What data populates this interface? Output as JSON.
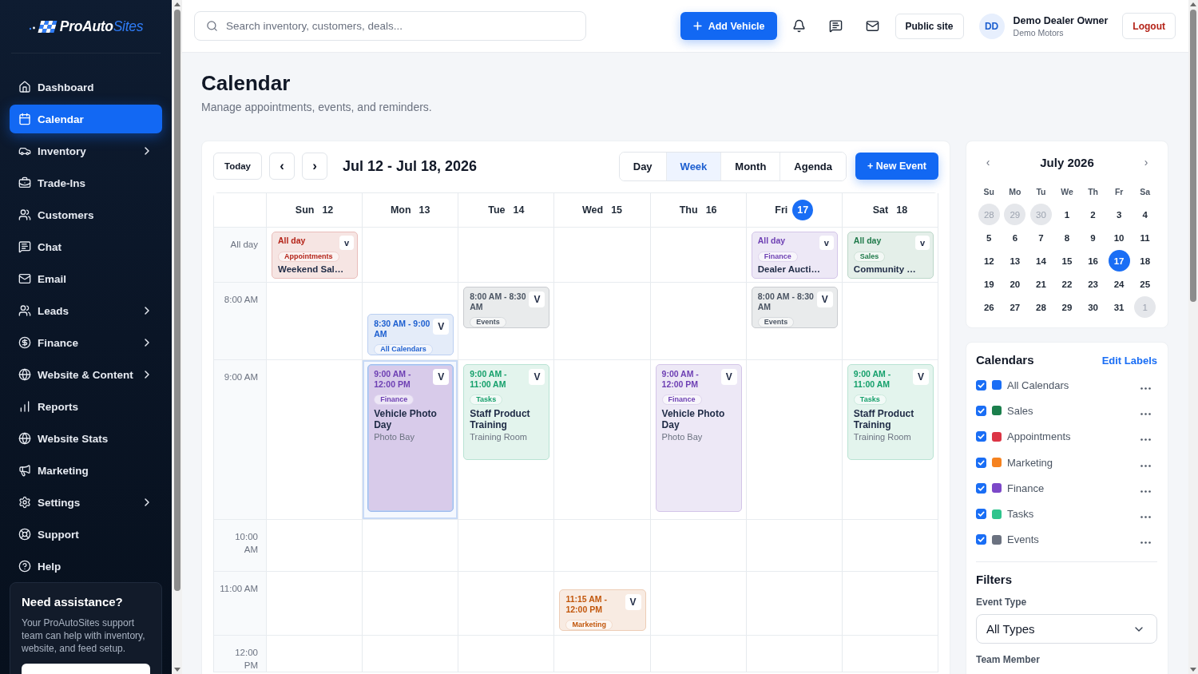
{
  "sidebar": {
    "logo": {
      "brand": "ProAuto",
      "accent": "Sites"
    },
    "nav": [
      {
        "label": "Dashboard",
        "expandable": false,
        "selected": false
      },
      {
        "label": "Calendar",
        "expandable": false,
        "selected": true
      },
      {
        "label": "Inventory",
        "expandable": true,
        "selected": false
      },
      {
        "label": "Trade-Ins",
        "expandable": false,
        "selected": false
      },
      {
        "label": "Customers",
        "expandable": false,
        "selected": false
      },
      {
        "label": "Chat",
        "expandable": false,
        "selected": false
      },
      {
        "label": "Email",
        "expandable": false,
        "selected": false
      },
      {
        "label": "Leads",
        "expandable": true,
        "selected": false
      },
      {
        "label": "Finance",
        "expandable": true,
        "selected": false
      },
      {
        "label": "Website & Content",
        "expandable": true,
        "selected": false
      },
      {
        "label": "Reports",
        "expandable": false,
        "selected": false
      },
      {
        "label": "Website Stats",
        "expandable": false,
        "selected": false
      },
      {
        "label": "Marketing",
        "expandable": false,
        "selected": false
      },
      {
        "label": "Settings",
        "expandable": true,
        "selected": false
      },
      {
        "label": "Support",
        "expandable": false,
        "selected": false
      },
      {
        "label": "Help",
        "expandable": false,
        "selected": false
      }
    ],
    "help_card": {
      "title": "Need assistance?",
      "text": "Your ProAutoSites support team can help with inventory, website, and feed setup."
    }
  },
  "topbar": {
    "search": {
      "placeholder": "Search inventory, customers, deals..."
    },
    "add_vehicle": "Add Vehicle",
    "public_site": "Public site",
    "user": {
      "initials": "DD",
      "name": "Demo Dealer Owner",
      "company": "Demo Motors"
    },
    "logout": "Logout"
  },
  "page": {
    "title": "Calendar",
    "subtitle": "Manage appointments, events, and reminders."
  },
  "calendar": {
    "today": "Today",
    "prev": "‹",
    "next": "›",
    "range": "Jul 12 - Jul 18, 2026",
    "views": [
      {
        "label": "Day",
        "selected": false
      },
      {
        "label": "Week",
        "selected": true
      },
      {
        "label": "Month",
        "selected": false
      },
      {
        "label": "Agenda",
        "selected": false
      }
    ],
    "new_event": "+ New Event",
    "days": [
      {
        "name": "Sun",
        "date": "12",
        "today": false
      },
      {
        "name": "Mon",
        "date": "13",
        "today": false
      },
      {
        "name": "Tue",
        "date": "14",
        "today": false
      },
      {
        "name": "Wed",
        "date": "15",
        "today": false
      },
      {
        "name": "Thu",
        "date": "16",
        "today": false
      },
      {
        "name": "Fri",
        "date": "17",
        "today": true
      },
      {
        "name": "Sat",
        "date": "18",
        "today": false
      }
    ],
    "rows": [
      {
        "label": "All day",
        "cells": [
          {
            "event": {
              "kind": "allday",
              "time": "All day",
              "menu": "v",
              "tag": "Appointments",
              "title": "Weekend Sal…",
              "color": "#b42318",
              "selected": false
            }
          },
          {},
          {},
          {},
          {},
          {
            "event": {
              "kind": "allday",
              "time": "All day",
              "menu": "v",
              "tag": "Finance",
              "title": "Dealer Aucti…",
              "color": "#6d3fb3",
              "selected": false
            }
          },
          {
            "event": {
              "kind": "allday",
              "time": "All day",
              "menu": "v",
              "tag": "Sales",
              "title": "Community …",
              "color": "#1f7a4a",
              "selected": false
            }
          }
        ]
      },
      {
        "label": "8:00 AM",
        "cells": [
          {},
          {
            "event": {
              "kind": "halfpast",
              "time": "8:30 AM - 9:00 AM",
              "menu": "V",
              "tag": "All Calendars",
              "color": "#1d5fd0",
              "selected": false
            }
          },
          {
            "event": {
              "kind": "brief",
              "time": "8:00 AM - 8:30 AM",
              "menu": "V",
              "tag": "Events",
              "color": "#4b5563",
              "selected": false
            }
          },
          {},
          {},
          {
            "event": {
              "kind": "brief",
              "time": "8:00 AM - 8:30 AM",
              "menu": "V",
              "tag": "Events",
              "color": "#4b5563",
              "selected": false
            }
          },
          {}
        ]
      },
      {
        "label": "9:00 AM",
        "cells": [
          {},
          {
            "event": {
              "kind": "threehour",
              "time": "9:00 AM - 12:00 PM",
              "menu": "V",
              "tag": "Finance",
              "title": "Vehicle Photo Day",
              "location": "Photo Bay",
              "color": "#6d3fb3",
              "selected": true
            }
          },
          {
            "event": {
              "kind": "twohour",
              "time": "9:00 AM - 11:00 AM",
              "menu": "V",
              "tag": "Tasks",
              "title": "Staff Product Training",
              "location": "Training Room",
              "color": "#15a06b",
              "selected": false
            }
          },
          {},
          {
            "event": {
              "kind": "threehour",
              "time": "9:00 AM - 12:00 PM",
              "menu": "V",
              "tag": "Finance",
              "title": "Vehicle Photo Day",
              "location": "Photo Bay",
              "color": "#6d3fb3",
              "selected": false
            }
          },
          {},
          {
            "event": {
              "kind": "twohour",
              "time": "9:00 AM - 11:00 AM",
              "menu": "V",
              "tag": "Tasks",
              "title": "Staff Product Training",
              "location": "Training Room",
              "color": "#15a06b",
              "selected": false
            }
          }
        ]
      },
      {
        "label": "10:00 AM",
        "cells": [
          {},
          {},
          {},
          {},
          {},
          {},
          {}
        ]
      },
      {
        "label": "11:00 AM",
        "cells": [
          {},
          {},
          {},
          {
            "event": {
              "kind": "quarterpast",
              "time": "11:15 AM - 12:00 PM",
              "menu": "V",
              "tag": "Marketing",
              "color": "#c2570c",
              "selected": false
            }
          },
          {},
          {},
          {}
        ]
      },
      {
        "label": "12:00 PM",
        "cells": [
          {},
          {},
          {},
          {},
          {},
          {},
          {}
        ]
      }
    ]
  },
  "mini_calendar": {
    "prev": "‹",
    "month": "July 2026",
    "next": "›",
    "weekdays": [
      "Su",
      "Mo",
      "Tu",
      "We",
      "Th",
      "Fr",
      "Sa"
    ],
    "weeks": [
      {
        "days": [
          {
            "label": "28",
            "outside": true,
            "selected": false
          },
          {
            "label": "29",
            "outside": true,
            "selected": false
          },
          {
            "label": "30",
            "outside": true,
            "selected": false
          },
          {
            "label": "1",
            "outside": false,
            "selected": false
          },
          {
            "label": "2",
            "outside": false,
            "selected": false
          },
          {
            "label": "3",
            "outside": false,
            "selected": false
          },
          {
            "label": "4",
            "outside": false,
            "selected": false
          }
        ]
      },
      {
        "days": [
          {
            "label": "5",
            "outside": false,
            "selected": false
          },
          {
            "label": "6",
            "outside": false,
            "selected": false
          },
          {
            "label": "7",
            "outside": false,
            "selected": false
          },
          {
            "label": "8",
            "outside": false,
            "selected": false
          },
          {
            "label": "9",
            "outside": false,
            "selected": false
          },
          {
            "label": "10",
            "outside": false,
            "selected": false
          },
          {
            "label": "11",
            "outside": false,
            "selected": false
          }
        ]
      },
      {
        "days": [
          {
            "label": "12",
            "outside": false,
            "selected": false
          },
          {
            "label": "13",
            "outside": false,
            "selected": false
          },
          {
            "label": "14",
            "outside": false,
            "selected": false
          },
          {
            "label": "15",
            "outside": false,
            "selected": false
          },
          {
            "label": "16",
            "outside": false,
            "selected": false
          },
          {
            "label": "17",
            "outside": false,
            "selected": true
          },
          {
            "label": "18",
            "outside": false,
            "selected": false
          }
        ]
      },
      {
        "days": [
          {
            "label": "19",
            "outside": false,
            "selected": false
          },
          {
            "label": "20",
            "outside": false,
            "selected": false
          },
          {
            "label": "21",
            "outside": false,
            "selected": false
          },
          {
            "label": "22",
            "outside": false,
            "selected": false
          },
          {
            "label": "23",
            "outside": false,
            "selected": false
          },
          {
            "label": "24",
            "outside": false,
            "selected": false
          },
          {
            "label": "25",
            "outside": false,
            "selected": false
          }
        ]
      },
      {
        "days": [
          {
            "label": "26",
            "outside": false,
            "selected": false
          },
          {
            "label": "27",
            "outside": false,
            "selected": false
          },
          {
            "label": "28",
            "outside": false,
            "selected": false
          },
          {
            "label": "29",
            "outside": false,
            "selected": false
          },
          {
            "label": "30",
            "outside": false,
            "selected": false
          },
          {
            "label": "31",
            "outside": false,
            "selected": false
          },
          {
            "label": "1",
            "outside": true,
            "selected": false
          }
        ]
      }
    ]
  },
  "calendars": {
    "title": "Calendars",
    "edit": "Edit Labels",
    "items": [
      {
        "name": "All Calendars",
        "color": "#1a6ef5",
        "checked": true
      },
      {
        "name": "Sales",
        "color": "#1b7f4c",
        "checked": true
      },
      {
        "name": "Appointments",
        "color": "#dc3545",
        "checked": true
      },
      {
        "name": "Marketing",
        "color": "#f5821f",
        "checked": true
      },
      {
        "name": "Finance",
        "color": "#7c48c8",
        "checked": true
      },
      {
        "name": "Tasks",
        "color": "#2fc48d",
        "checked": true
      },
      {
        "name": "Events",
        "color": "#6b7280",
        "checked": true
      }
    ]
  },
  "filters": {
    "title": "Filters",
    "event_type": {
      "label": "Event Type",
      "value": "All Types"
    },
    "team_member": {
      "label": "Team Member"
    }
  }
}
